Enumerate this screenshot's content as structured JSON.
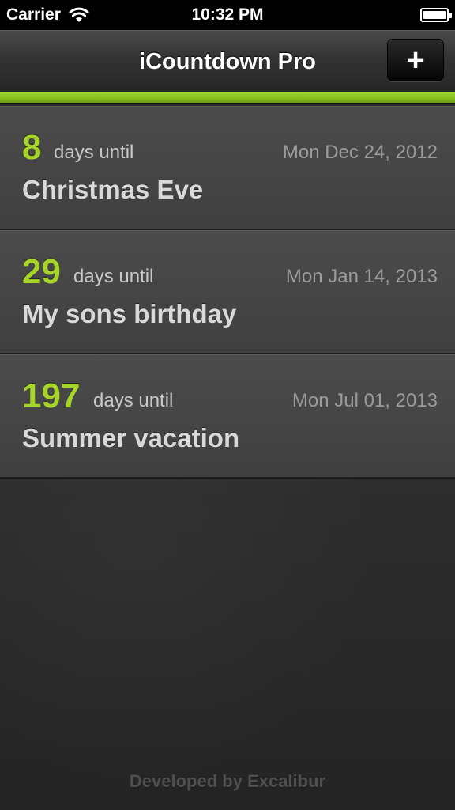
{
  "status_bar": {
    "carrier": "Carrier",
    "time": "10:32 PM",
    "wifi_icon": "wifi-icon",
    "battery_icon": "battery-icon"
  },
  "nav": {
    "title": "iCountdown Pro",
    "add_label": "+"
  },
  "colors": {
    "accent": "#9ed32f",
    "count": "#a6d42a"
  },
  "countdowns": [
    {
      "count": "8",
      "until": "days until",
      "date": "Mon Dec 24, 2012",
      "event": "Christmas Eve"
    },
    {
      "count": "29",
      "until": "days until",
      "date": "Mon Jan 14, 2013",
      "event": "My sons birthday"
    },
    {
      "count": "197",
      "until": "days until",
      "date": "Mon Jul 01, 2013",
      "event": "Summer vacation"
    }
  ],
  "footer": "Developed by Excalibur"
}
